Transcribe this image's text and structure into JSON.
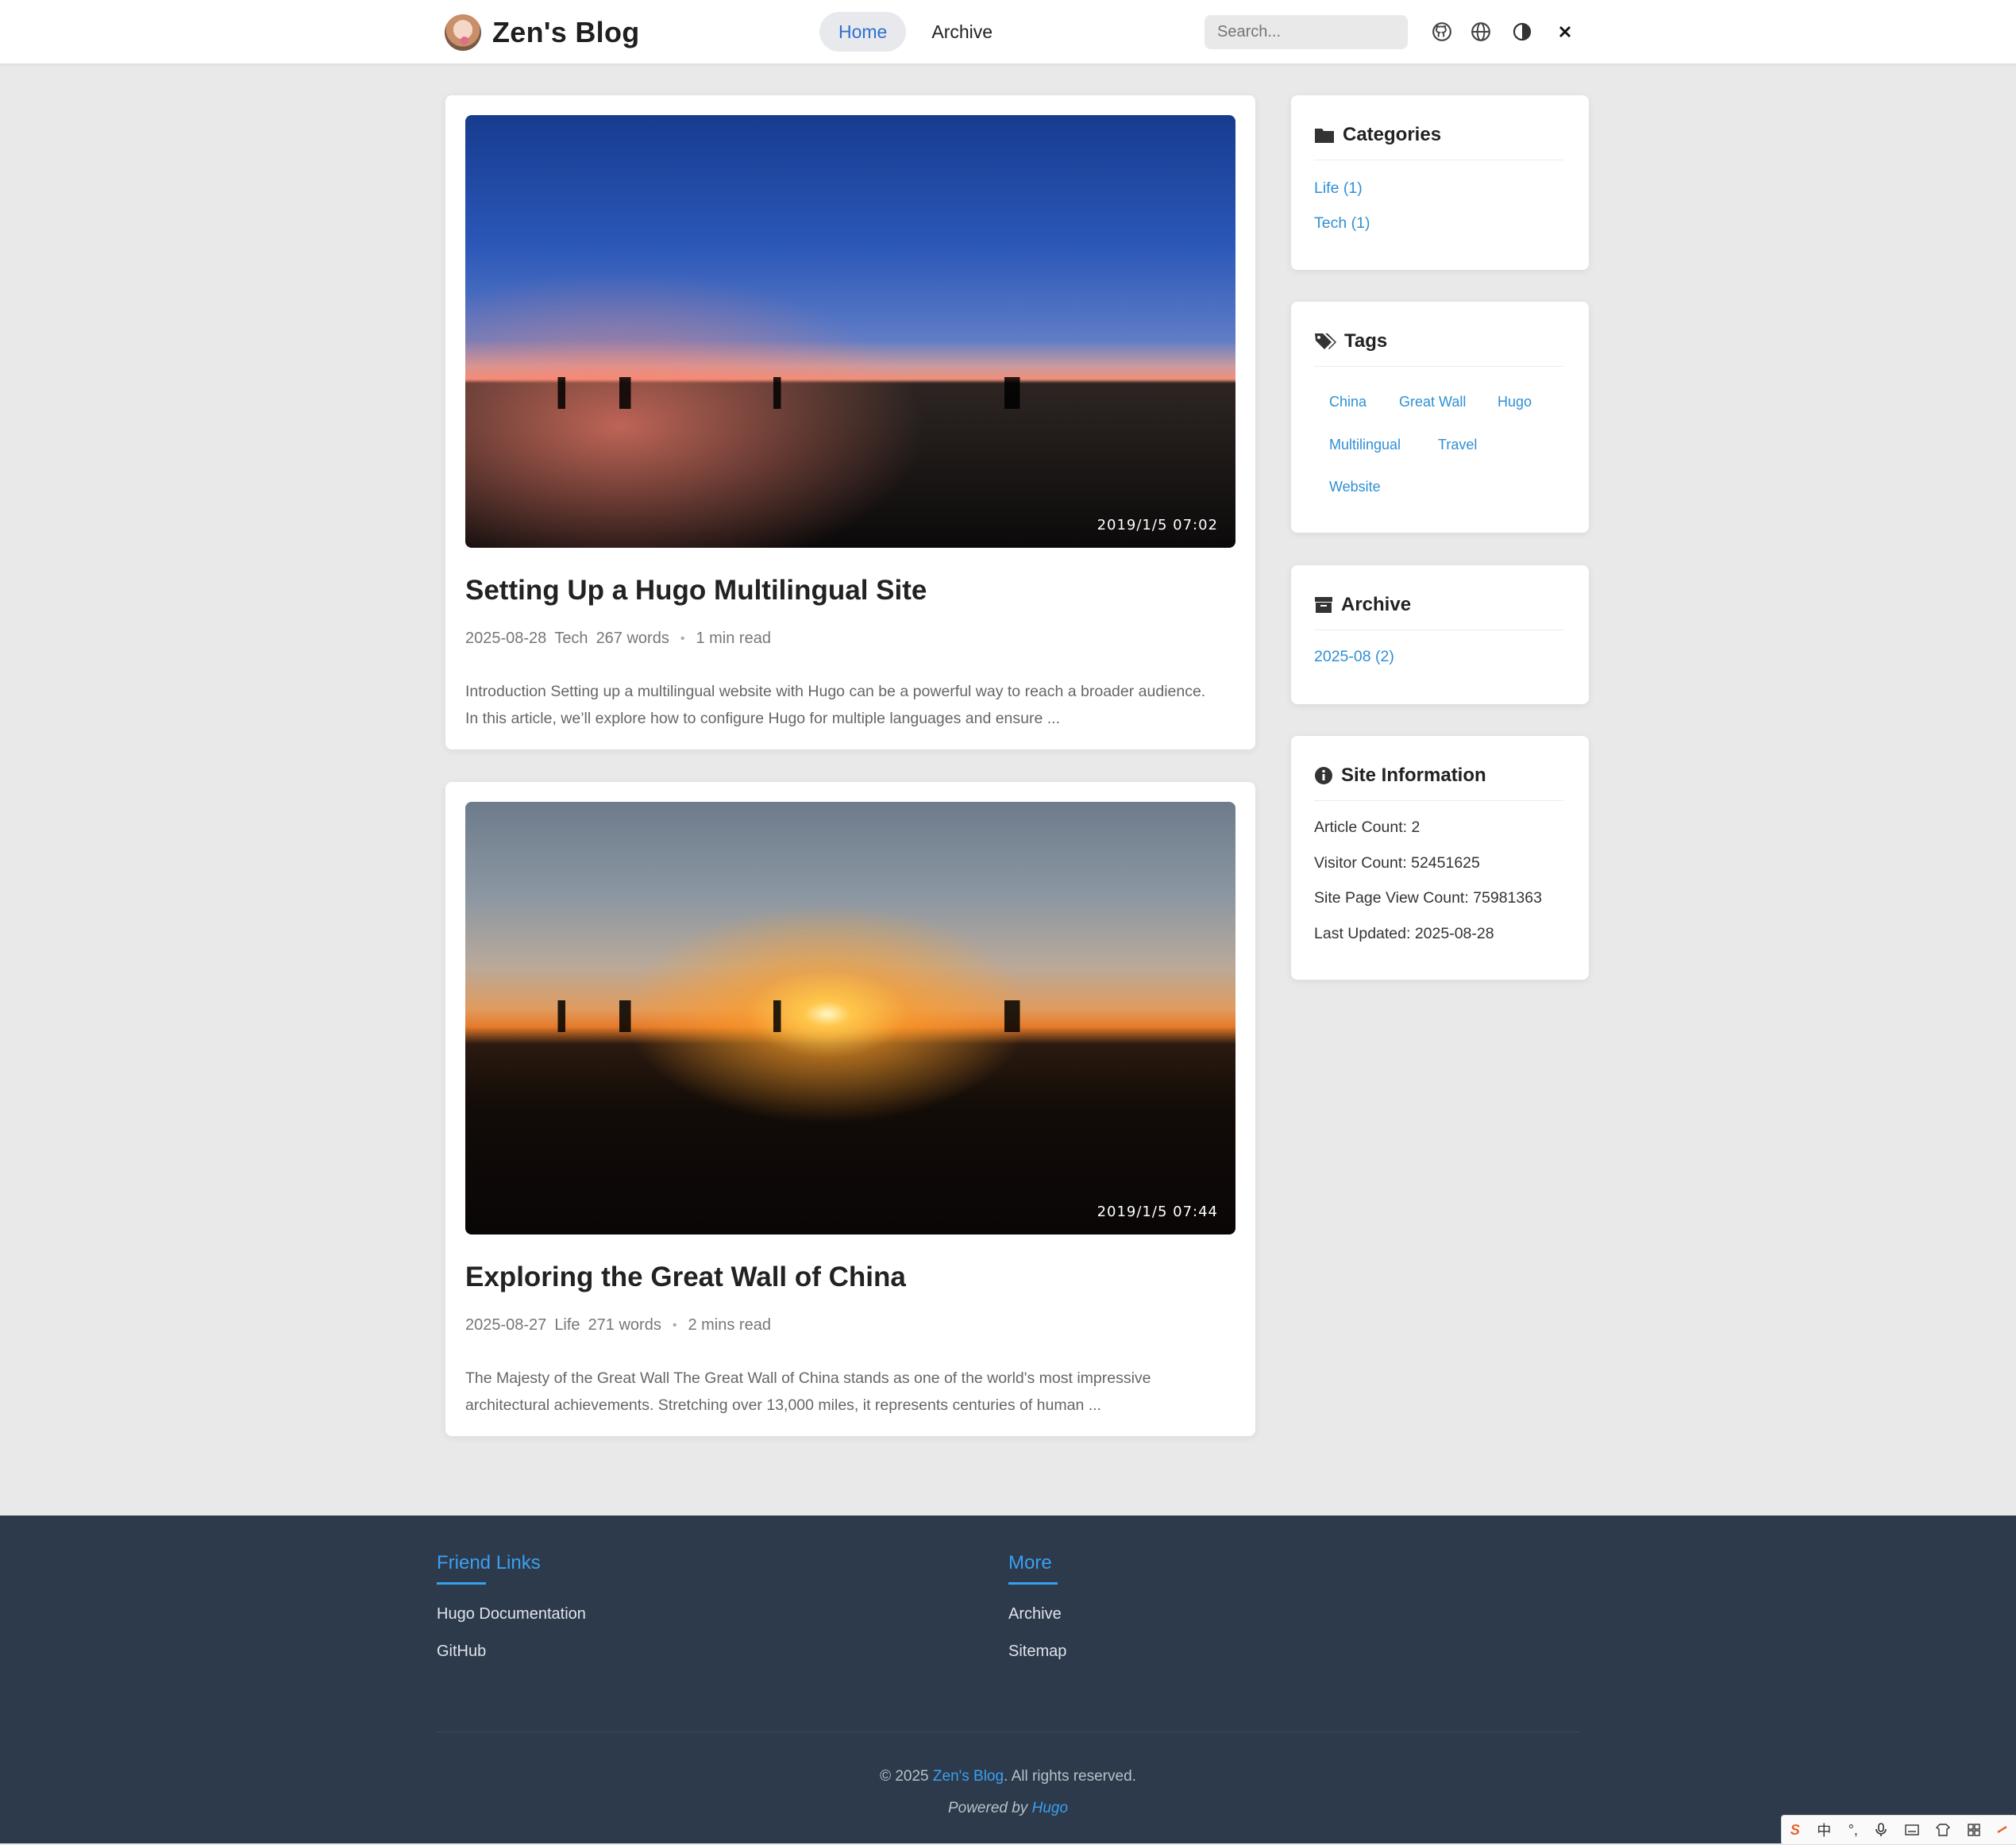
{
  "header": {
    "site_title": "Zen's Blog",
    "nav": [
      {
        "label": "Home",
        "active": true
      },
      {
        "label": "Archive",
        "active": false
      }
    ],
    "search_placeholder": "Search...",
    "icons": [
      "github-icon",
      "globe-icon",
      "contrast-icon",
      "close-icon"
    ]
  },
  "posts": [
    {
      "image_timestamp": "2019/1/5  07:02",
      "title": "Setting Up a Hugo Multilingual Site",
      "date": "2025-08-28",
      "category": "Tech",
      "words": "267 words",
      "read_time": "1 min read",
      "excerpt_line1": "Introduction Setting up a multilingual website with Hugo can be a powerful way to reach a broader audience.",
      "excerpt_line2": "In this article, we’ll explore how to configure Hugo for multiple languages and ensure ..."
    },
    {
      "image_timestamp": "2019/1/5  07:44",
      "title": "Exploring the Great Wall of China",
      "date": "2025-08-27",
      "category": "Life",
      "words": "271 words",
      "read_time": "2 mins read",
      "excerpt_line1": "The Majesty of the Great Wall The Great Wall of China stands as one of the world's most impressive",
      "excerpt_line2": "architectural achievements. Stretching over 13,000 miles, it represents centuries of human ..."
    }
  ],
  "sidebar": {
    "categories": {
      "title": "Categories",
      "items": [
        "Life (1)",
        "Tech (1)"
      ]
    },
    "tags": {
      "title": "Tags",
      "items": [
        "China",
        "Great Wall",
        "Hugo",
        "Multilingual",
        "Travel",
        "Website"
      ]
    },
    "archive": {
      "title": "Archive",
      "items": [
        "2025-08 (2)"
      ]
    },
    "site_info": {
      "title": "Site Information",
      "items": [
        "Article Count: 2",
        "Visitor Count: 52451625",
        "Site Page View Count: 75981363",
        "Last Updated: 2025-08-28"
      ]
    }
  },
  "footer": {
    "friend_links": {
      "title": "Friend Links",
      "items": [
        "Hugo Documentation",
        "GitHub"
      ]
    },
    "more": {
      "title": "More",
      "items": [
        "Archive",
        "Sitemap"
      ]
    },
    "copyright_prefix": "© 2025 ",
    "copyright_site": "Zen's Blog",
    "copyright_suffix": ". All rights reserved.",
    "powered_prefix": "Powered by ",
    "powered_link": "Hugo"
  },
  "ime_bar": {
    "logo": "S",
    "lang": "中",
    "icons": [
      "punctuation-icon",
      "microphone-icon",
      "keyboard-icon",
      "skin-icon",
      "toolbox-icon",
      "extra-icon"
    ]
  },
  "colors": {
    "accent": "#2f8fd5",
    "footer_bg": "#2d3a4b",
    "page_bg": "#e9e9e9"
  }
}
